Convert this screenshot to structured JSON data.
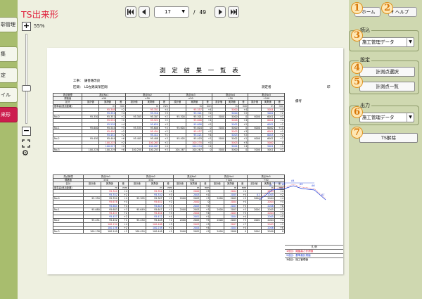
{
  "window": {
    "title": "TS出来形"
  },
  "sidebar": {
    "tabs": [
      {
        "label": "彰管理",
        "active": false
      },
      {
        "label": "集",
        "active": false
      },
      {
        "label": "定",
        "active": false
      },
      {
        "label": "イル",
        "active": false
      },
      {
        "label": "来形",
        "active": true
      }
    ]
  },
  "navigation": {
    "current_page": "17",
    "separator": "/",
    "total_pages": "49"
  },
  "zoom": {
    "level": "55%"
  },
  "document": {
    "title": "測 定 結 果 一 覧 表",
    "meta_left1": "工事：　謙善路改良",
    "meta_left2": "区間：　LD左路高架区間",
    "meta_right1": "測定者",
    "meta_right2": "印",
    "remark_label": "備考",
    "block1": {
      "header_top": [
        "測点管理",
        "測点No1",
        "測点No2",
        "測点No3",
        "測点No4",
        "測点No5"
      ],
      "row2": [
        "規格値",
        "±50",
        "±50",
        "±50",
        "+50",
        "+100"
      ],
      "row3": [
        "区分",
        "設計値",
        "実測値",
        "差",
        "設計値",
        "実測値",
        "差",
        "設計値",
        "実測値",
        "差",
        "設計値",
        "実測値",
        "差",
        "設計値",
        "実測値",
        "差"
      ],
      "rows": [
        {
          "label": "基準高(追加距離)",
          "cells": [
            "",
            "m",
            "mm",
            "",
            "m",
            "mm",
            "",
            "m",
            "mm",
            "",
            "m",
            "mm",
            "",
            "m",
            "mm"
          ]
        },
        {
          "label": "",
          "cells": [
            "",
            "95.348",
            "+2",
            "",
            "95.351",
            "+4",
            "",
            "95.357",
            "+4",
            "",
            "5000",
            "+4",
            "",
            "5004",
            "+4"
          ]
        },
        {
          "label": "",
          "cells": [
            "",
            "95.354",
            "+4",
            "",
            "95.310",
            "+3",
            "",
            "95.301",
            "+2",
            "",
            "5000",
            "+2",
            "",
            "5002",
            "+2"
          ]
        },
        {
          "label": "No.0",
          "cells": [
            "95.350",
            "95.351",
            "+1",
            "95.305",
            "95.307",
            "+2",
            "95.300",
            "95.301",
            "+1",
            "5000",
            "5000",
            "0",
            "6000",
            "6001",
            "+1"
          ]
        },
        {
          "label": "",
          "cells": [
            "",
            "95.532",
            "+2",
            "",
            "95.522",
            "+2",
            "",
            "95.606",
            "+4",
            "",
            "5008",
            "+4",
            "",
            "6004",
            "+4"
          ]
        },
        {
          "label": "",
          "cells": [
            "",
            "95.528",
            "+4",
            "",
            "95.620",
            "+3",
            "",
            "95.608",
            "+2",
            "",
            "5002",
            "+2",
            "",
            "6002",
            "+2"
          ]
        },
        {
          "label": "No.1",
          "cells": [
            "95.600",
            "95.544",
            "+5",
            "95.535",
            "95.608",
            "+4",
            "95.604",
            "95.604",
            "0",
            "5000",
            "5000",
            "0",
            "6000",
            "6000",
            "+10"
          ]
        },
        {
          "label": "",
          "cells": [
            "",
            "95.450",
            "+2",
            "",
            "95.454",
            "+2",
            "",
            "95.457",
            "+2",
            "",
            "5003",
            "+3",
            "",
            "6001",
            "+1"
          ]
        },
        {
          "label": "",
          "cells": [
            "",
            "95.452",
            "+2",
            "",
            "95.412",
            "+1",
            "",
            "95.421",
            "+4",
            "",
            "5003",
            "+2",
            "",
            "6003",
            "+2"
          ]
        },
        {
          "label": "No.2",
          "cells": [
            "95.450",
            "95.444",
            "+6",
            "95.405",
            "95.408",
            "+3",
            "95.405",
            "95.403",
            "+2",
            "5000",
            "5002",
            "+2",
            "6000",
            "6002",
            "+2"
          ]
        },
        {
          "label": "",
          "cells": [
            "",
            "100.225",
            "+2",
            "",
            "100.263",
            "+2",
            "",
            "100.235",
            "+2",
            "",
            "5003",
            "+3",
            "",
            "5000",
            "0"
          ]
        },
        {
          "label": "",
          "cells": [
            "",
            "100.227",
            "+2",
            "",
            "100.267",
            "+4",
            "",
            "100.234",
            "+4",
            "",
            "5004",
            "+4",
            "",
            "5001",
            "+1"
          ]
        },
        {
          "label": "No.3",
          "cells": [
            "100.225",
            "100.219",
            "+6",
            "100.250",
            "100.253",
            "+3",
            "100.267",
            "100.267",
            "0",
            "5000",
            "5000",
            "0",
            "5000",
            "5001",
            "+1"
          ]
        }
      ]
    },
    "block2": {
      "header_top": [
        "測点管理",
        "測点No1",
        "測点No2",
        "測点No3",
        "測点No4",
        "測点No5"
      ],
      "row2": [
        "規格値",
        "±50",
        "±50",
        "+50",
        "+100",
        "+50"
      ],
      "row3": [
        "区分",
        "設計値",
        "実測値",
        "差",
        "設計値",
        "実測値",
        "差",
        "設計値",
        "実測値",
        "差",
        "設計値",
        "実測値",
        "差",
        "設計値",
        "実測値",
        "差"
      ],
      "rows": [
        {
          "label": "基準高(追加距離)",
          "cells": [
            "",
            "m",
            "mm",
            "",
            "m",
            "mm",
            "",
            "m",
            "mm",
            "",
            "m",
            "mm",
            "",
            "m",
            "mm"
          ]
        },
        {
          "label": "",
          "cells": [
            "",
            "95.344",
            "+4",
            "",
            "95.354",
            "+4",
            "",
            "2000",
            "+3",
            "",
            "2004",
            "+4",
            "",
            "2004",
            "+4"
          ]
        },
        {
          "label": "",
          "cells": [
            "",
            "95.352",
            "+2",
            "",
            "95.310",
            "+3",
            "",
            "2003",
            "+1",
            "",
            "2005",
            "+4",
            "",
            "2005",
            "+2"
          ]
        },
        {
          "label": "No.0",
          "cells": [
            "95.350",
            "95.354",
            "+4",
            "95.305",
            "95.307",
            "+2",
            "2000",
            "2003",
            "+3",
            "2000",
            "2005",
            "+5",
            "2000",
            "2004",
            "+4"
          ]
        },
        {
          "label": "",
          "cells": [
            "",
            "95.678",
            "+4",
            "",
            "95.632",
            "+2",
            "",
            "2000",
            "0",
            "",
            "2004",
            "+4",
            "",
            "2004",
            "+4"
          ]
        },
        {
          "label": "",
          "cells": [
            "",
            "95.684",
            "+4",
            "",
            "95.643",
            "+3",
            "",
            "2005",
            "+5",
            "",
            "2003",
            "+3",
            "",
            "2006",
            "+6"
          ]
        },
        {
          "label": "No.1",
          "cells": [
            "95.680",
            "95.683",
            "+3",
            "95.649",
            "95.647",
            "+2",
            "2000",
            "2003",
            "+3",
            "2000",
            "2003",
            "+3",
            "2000",
            "2005",
            "+5"
          ]
        },
        {
          "label": "",
          "cells": [
            "",
            "95.457",
            "+2",
            "",
            "95.454",
            "+3",
            "",
            "2004",
            "+4",
            "",
            "2003",
            "+3",
            "",
            "2004",
            "+4"
          ]
        },
        {
          "label": "",
          "cells": [
            "",
            "95.457",
            "+2",
            "",
            "95.412",
            "+4",
            "",
            "2001",
            "+1",
            "",
            "2004",
            "+4",
            "",
            "2005",
            "+5"
          ]
        },
        {
          "label": "No.2",
          "cells": [
            "95.451",
            "95.452",
            "+1",
            "95.450",
            "95.448",
            "+2",
            "2000",
            "2005",
            "+5",
            "2000",
            "2003",
            "+3",
            "2000",
            "2004",
            "+4"
          ]
        },
        {
          "label": "",
          "cells": [
            "",
            "100.134",
            "+4",
            "",
            "100.408",
            "+3",
            "",
            "2003",
            "+3",
            "",
            "2007",
            "+7",
            "",
            "2003",
            "+3"
          ]
        },
        {
          "label": "",
          "cells": [
            "",
            "100.136",
            "+2",
            "",
            "100.238",
            "+2",
            "",
            "2004",
            "+4",
            "",
            "2004",
            "+4",
            "",
            "2006",
            "+6"
          ]
        },
        {
          "label": "No.3",
          "cells": [
            "100.138",
            "100.140",
            "+2",
            "100.450",
            "100.448",
            "+2",
            "2000",
            "2002",
            "+2",
            "2000",
            "2000",
            "0",
            "2000",
            "2000",
            "0"
          ]
        }
      ]
    },
    "diagram_labels": [
      "A1",
      "A2",
      "A3",
      "A4",
      "A5",
      "A6",
      "A7"
    ],
    "legend": {
      "title": "凡 例",
      "items": [
        "1段目：路盤高さ計測値",
        "2段目：基準高計測値",
        "3段目：施工管理値"
      ]
    }
  },
  "right_panel": {
    "home_label": "ホーム",
    "help_label": "ヘルプ",
    "read_group_label": "読込",
    "read_select": "施工管理データ",
    "settings_group_label": "設定",
    "select_points_button": "計測点選択",
    "points_list_button": "計測点一覧",
    "output_group_label": "出力",
    "output_select": "施工管理データ",
    "ts_release_button": "TS解除",
    "markers": [
      "1",
      "2",
      "3",
      "4",
      "5",
      "6",
      "7"
    ]
  },
  "colors": {
    "title": "#e0203c",
    "sidebar": "#a8bd6e",
    "active_tab": "#cc1d4e",
    "panel": "#cfd8b0",
    "marker": "#e0901a"
  }
}
